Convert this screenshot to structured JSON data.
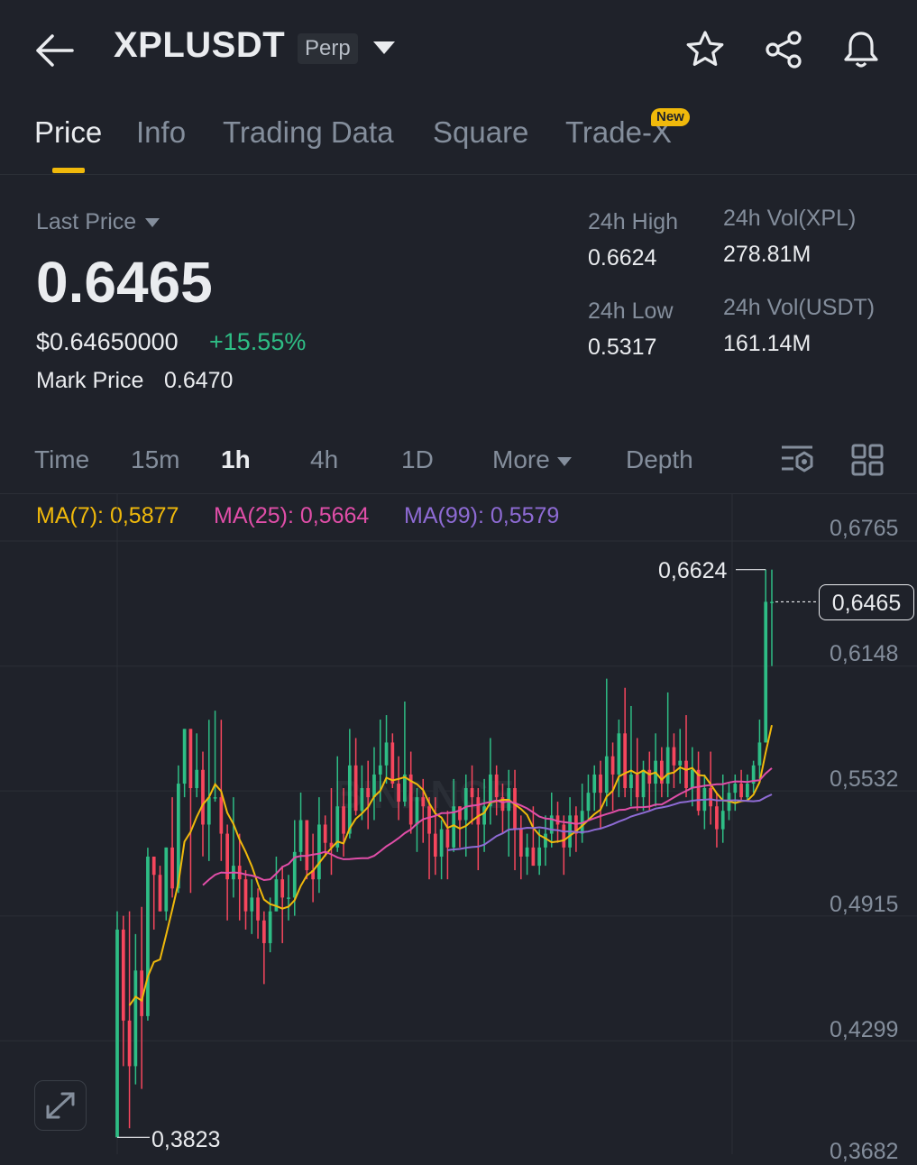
{
  "header": {
    "title": "XPLUSDT",
    "badge": "Perp"
  },
  "tabs": [
    {
      "label": "Price"
    },
    {
      "label": "Info"
    },
    {
      "label": "Trading Data"
    },
    {
      "label": "Square"
    },
    {
      "label": "Trade-X"
    }
  ],
  "new_badge": "New",
  "summary": {
    "last_price_label": "Last Price",
    "last_price": "0.6465",
    "usd_price": "$0.64650000",
    "change": "+15.55%",
    "mark_label": "Mark Price",
    "mark_value": "0.6470",
    "high_label": "24h High",
    "high_value": "0.6624",
    "low_label": "24h Low",
    "low_value": "0.5317",
    "vol_base_label": "24h Vol(XPL)",
    "vol_base_value": "278.81M",
    "vol_quote_label": "24h Vol(USDT)",
    "vol_quote_value": "161.14M"
  },
  "intervals": [
    "Time",
    "15m",
    "1h",
    "4h",
    "1D",
    "More",
    "Depth"
  ],
  "indicators": {
    "ma7": "MA(7): 0,5877",
    "ma25": "MA(25): 0,5664",
    "ma99": "MA(99): 0,5579"
  },
  "colors": {
    "up": "#2ebd85",
    "down": "#f6465d",
    "accent": "#f0b90b",
    "ma7": "#f0b90b",
    "ma25": "#e04ea8",
    "ma99": "#8e6bd4"
  },
  "chart_data": {
    "type": "candlestick",
    "y_ticks": [
      "0,6765",
      "0,6148",
      "0,5532",
      "0,4915",
      "0,4299",
      "0,3682"
    ],
    "ylim": [
      0.3682,
      0.6765
    ],
    "current_price_label": "0,6465",
    "high_label": "0,6624",
    "low_label": "0,3823",
    "current": 0.6465,
    "high": 0.6624,
    "low": 0.3823,
    "watermark": "BINANCE",
    "candles": [
      [
        0.3823,
        0.4848,
        0.3823,
        0.4938
      ],
      [
        0.4848,
        0.4399,
        0.4174,
        0.4916
      ],
      [
        0.4399,
        0.4174,
        0.3868,
        0.4938
      ],
      [
        0.4174,
        0.4646,
        0.4084,
        0.4826
      ],
      [
        0.4646,
        0.4421,
        0.4062,
        0.496
      ],
      [
        0.4421,
        0.5208,
        0.4399,
        0.5252
      ],
      [
        0.5208,
        0.5118,
        0.4848,
        0.5208
      ],
      [
        0.5118,
        0.4938,
        0.4938,
        0.5163
      ],
      [
        0.4938,
        0.5253,
        0.4893,
        0.5253
      ],
      [
        0.5253,
        0.5051,
        0.5006,
        0.5501
      ],
      [
        0.5051,
        0.5568,
        0.5029,
        0.5658
      ],
      [
        0.5568,
        0.5838,
        0.5501,
        0.5838
      ],
      [
        0.5838,
        0.5546,
        0.5029,
        0.5838
      ],
      [
        0.5546,
        0.5636,
        0.5501,
        0.5816
      ],
      [
        0.5636,
        0.5366,
        0.5209,
        0.5726
      ],
      [
        0.5366,
        0.5501,
        0.5186,
        0.5883
      ],
      [
        0.5501,
        0.5501,
        0.5479,
        0.5928
      ],
      [
        0.5501,
        0.5321,
        0.5186,
        0.5883
      ],
      [
        0.5321,
        0.5096,
        0.4893,
        0.5366
      ],
      [
        0.5096,
        0.5163,
        0.5006,
        0.5501
      ],
      [
        0.5163,
        0.5096,
        0.4893,
        0.5321
      ],
      [
        0.5096,
        0.4938,
        0.4848,
        0.5141
      ],
      [
        0.4938,
        0.5006,
        0.4826,
        0.5096
      ],
      [
        0.5006,
        0.4893,
        0.4803,
        0.5051
      ],
      [
        0.4893,
        0.4781,
        0.4579,
        0.4938
      ],
      [
        0.4781,
        0.4938,
        0.4736,
        0.5006
      ],
      [
        0.4938,
        0.5096,
        0.4938,
        0.5208
      ],
      [
        0.5096,
        0.5006,
        0.4781,
        0.5163
      ],
      [
        0.5006,
        0.5006,
        0.4893,
        0.5118
      ],
      [
        0.5006,
        0.5231,
        0.4916,
        0.5388
      ],
      [
        0.5231,
        0.5388,
        0.5186,
        0.5524
      ],
      [
        0.5388,
        0.5141,
        0.5096,
        0.5388
      ],
      [
        0.5141,
        0.5096,
        0.4983,
        0.5321
      ],
      [
        0.5096,
        0.5366,
        0.5029,
        0.5501
      ],
      [
        0.5366,
        0.5276,
        0.5208,
        0.5411
      ],
      [
        0.5276,
        0.5253,
        0.5118,
        0.5546
      ],
      [
        0.5253,
        0.5456,
        0.5231,
        0.5703
      ],
      [
        0.5456,
        0.5321,
        0.5208,
        0.5546
      ],
      [
        0.5321,
        0.5658,
        0.5298,
        0.5838
      ],
      [
        0.5658,
        0.5434,
        0.5411,
        0.5793
      ],
      [
        0.5434,
        0.5546,
        0.5388,
        0.5658
      ],
      [
        0.5546,
        0.5501,
        0.5343,
        0.5681
      ],
      [
        0.5501,
        0.5613,
        0.5388,
        0.5748
      ],
      [
        0.5613,
        0.5658,
        0.5479,
        0.5884
      ],
      [
        0.5658,
        0.5771,
        0.5568,
        0.5906
      ],
      [
        0.5771,
        0.5568,
        0.5546,
        0.5816
      ],
      [
        0.5568,
        0.5479,
        0.5388,
        0.5703
      ],
      [
        0.5479,
        0.5613,
        0.5456,
        0.5973
      ],
      [
        0.5613,
        0.5366,
        0.5321,
        0.5726
      ],
      [
        0.5366,
        0.5501,
        0.5231,
        0.5546
      ],
      [
        0.5501,
        0.5456,
        0.5276,
        0.5591
      ],
      [
        0.5456,
        0.5321,
        0.5096,
        0.5501
      ],
      [
        0.5321,
        0.5208,
        0.5118,
        0.5501
      ],
      [
        0.5208,
        0.5343,
        0.5096,
        0.5388
      ],
      [
        0.5343,
        0.5253,
        0.5096,
        0.5434
      ],
      [
        0.5253,
        0.5456,
        0.5231,
        0.5591
      ],
      [
        0.5456,
        0.5388,
        0.5253,
        0.5456
      ],
      [
        0.5388,
        0.5546,
        0.5208,
        0.5613
      ],
      [
        0.5546,
        0.5501,
        0.5366,
        0.5658
      ],
      [
        0.5501,
        0.5366,
        0.5141,
        0.5546
      ],
      [
        0.5366,
        0.5456,
        0.5231,
        0.5591
      ],
      [
        0.5456,
        0.5613,
        0.5366,
        0.5793
      ],
      [
        0.5613,
        0.5501,
        0.5411,
        0.5658
      ],
      [
        0.5501,
        0.5434,
        0.5321,
        0.5568
      ],
      [
        0.5434,
        0.5546,
        0.5208,
        0.5636
      ],
      [
        0.5546,
        0.5343,
        0.5141,
        0.5636
      ],
      [
        0.5343,
        0.5208,
        0.5096,
        0.5411
      ],
      [
        0.5208,
        0.5253,
        0.5118,
        0.5321
      ],
      [
        0.5253,
        0.5163,
        0.5163,
        0.5456
      ],
      [
        0.5163,
        0.5253,
        0.5118,
        0.5343
      ],
      [
        0.5253,
        0.5321,
        0.5163,
        0.5411
      ],
      [
        0.5321,
        0.5411,
        0.5253,
        0.5524
      ],
      [
        0.5411,
        0.5366,
        0.5276,
        0.5479
      ],
      [
        0.5366,
        0.5253,
        0.5118,
        0.5411
      ],
      [
        0.5253,
        0.5411,
        0.5208,
        0.5501
      ],
      [
        0.5411,
        0.5321,
        0.5231,
        0.5456
      ],
      [
        0.5321,
        0.5434,
        0.5276,
        0.5568
      ],
      [
        0.5434,
        0.5523,
        0.5388,
        0.5613
      ],
      [
        0.5523,
        0.5613,
        0.5434,
        0.5658
      ],
      [
        0.5613,
        0.5523,
        0.5343,
        0.5681
      ],
      [
        0.5523,
        0.5703,
        0.5456,
        0.6086
      ],
      [
        0.5703,
        0.5613,
        0.5434,
        0.5771
      ],
      [
        0.5613,
        0.5816,
        0.5501,
        0.5884
      ],
      [
        0.5816,
        0.5546,
        0.5501,
        0.6041
      ],
      [
        0.5546,
        0.5613,
        0.5456,
        0.5951
      ],
      [
        0.5613,
        0.5501,
        0.5434,
        0.5793
      ],
      [
        0.5501,
        0.5636,
        0.5434,
        0.5681
      ],
      [
        0.5636,
        0.5568,
        0.5434,
        0.5726
      ],
      [
        0.5568,
        0.5681,
        0.5456,
        0.5816
      ],
      [
        0.5681,
        0.5568,
        0.5501,
        0.5748
      ],
      [
        0.5568,
        0.5748,
        0.5501,
        0.6018
      ],
      [
        0.5748,
        0.5658,
        0.5546,
        0.5816
      ],
      [
        0.5658,
        0.5681,
        0.5568,
        0.5838
      ],
      [
        0.5681,
        0.5546,
        0.5501,
        0.5906
      ],
      [
        0.5546,
        0.5636,
        0.5456,
        0.5748
      ],
      [
        0.5636,
        0.5434,
        0.5411,
        0.5726
      ],
      [
        0.5434,
        0.5546,
        0.5343,
        0.5613
      ],
      [
        0.5546,
        0.5456,
        0.5366,
        0.5726
      ],
      [
        0.5456,
        0.5343,
        0.5253,
        0.5523
      ],
      [
        0.5343,
        0.5434,
        0.5276,
        0.5613
      ],
      [
        0.5434,
        0.5523,
        0.5388,
        0.5568
      ],
      [
        0.5523,
        0.5568,
        0.5434,
        0.5613
      ],
      [
        0.5568,
        0.5501,
        0.5479,
        0.5636
      ],
      [
        0.5501,
        0.5568,
        0.5479,
        0.5613
      ],
      [
        0.5568,
        0.5658,
        0.5523,
        0.5681
      ],
      [
        0.5658,
        0.5771,
        0.5591,
        0.5884
      ],
      [
        0.5771,
        0.6465,
        0.5771,
        0.6624
      ],
      [
        0.6465,
        0.6465,
        0.6148,
        0.6624
      ]
    ]
  }
}
